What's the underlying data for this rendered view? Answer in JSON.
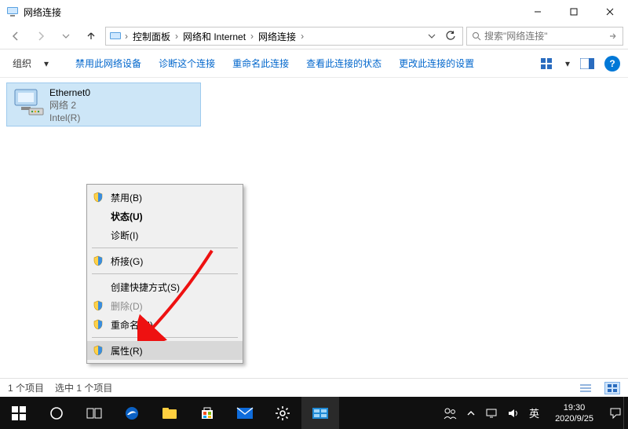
{
  "window": {
    "title": "网络连接",
    "min": "–",
    "max": "☐",
    "close": "✕"
  },
  "breadcrumbs": {
    "root": "",
    "items": [
      "控制面板",
      "网络和 Internet",
      "网络连接"
    ]
  },
  "search": {
    "placeholder": "搜索\"网络连接\""
  },
  "commands": {
    "organize": "组织",
    "disable": "禁用此网络设备",
    "diagnose": "诊断这个连接",
    "rename": "重命名此连接",
    "viewstatus": "查看此连接的状态",
    "changeset": "更改此连接的设置",
    "help": "?"
  },
  "adapter": {
    "name": "Ethernet0",
    "status": "网络 2",
    "device": "Intel(R)"
  },
  "context_menu": {
    "items": [
      {
        "label": "禁用(B)",
        "shield": true,
        "enabled": true,
        "bold": false
      },
      {
        "label": "状态(U)",
        "shield": false,
        "enabled": true,
        "bold": true
      },
      {
        "label": "诊断(I)",
        "shield": false,
        "enabled": true,
        "bold": false
      },
      {
        "sep": true
      },
      {
        "label": "桥接(G)",
        "shield": true,
        "enabled": true,
        "bold": false
      },
      {
        "sep": true
      },
      {
        "label": "创建快捷方式(S)",
        "shield": false,
        "enabled": true,
        "bold": false
      },
      {
        "label": "删除(D)",
        "shield": true,
        "enabled": false,
        "bold": false
      },
      {
        "label": "重命名(M)",
        "shield": true,
        "enabled": true,
        "bold": false
      },
      {
        "sep": true
      },
      {
        "label": "属性(R)",
        "shield": true,
        "enabled": true,
        "bold": false,
        "hover": true
      }
    ]
  },
  "status": {
    "count": "1 个项目",
    "selected": "选中 1 个项目"
  },
  "tray": {
    "ime": "英",
    "time": "19:30",
    "date": "2020/9/25"
  }
}
